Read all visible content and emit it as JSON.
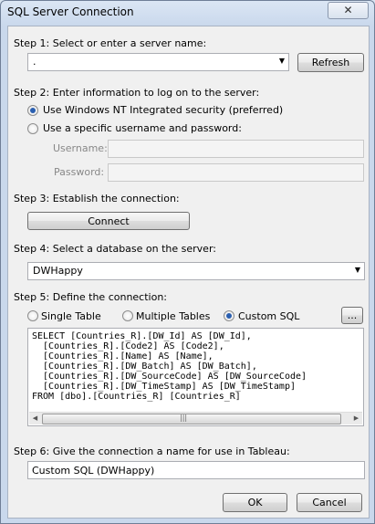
{
  "window": {
    "title": "SQL Server Connection",
    "close_label": "✕"
  },
  "step1": {
    "label": "Step 1: Select or enter a server name:",
    "server_value": ".",
    "refresh_label": "Refresh"
  },
  "step2": {
    "label": "Step 2: Enter information to log on to the server:",
    "option_windows": "Use Windows NT Integrated security (preferred)",
    "option_specific": "Use a specific username and password:",
    "username_label": "Username:",
    "password_label": "Password:",
    "username_value": "",
    "password_value": ""
  },
  "step3": {
    "label": "Step 3: Establish the connection:",
    "connect_label": "Connect"
  },
  "step4": {
    "label": "Step 4: Select a database on the server:",
    "database_value": "DWHappy"
  },
  "step5": {
    "label": "Step 5: Define the connection:",
    "option_single": "Single Table",
    "option_multiple": "Multiple Tables",
    "option_custom": "Custom SQL",
    "ellipsis_label": "...",
    "sql_lines": [
      "SELECT [Countries_R].[DW_Id] AS [DW_Id],",
      "  [Countries_R].[Code2] AS [Code2],",
      "  [Countries_R].[Name] AS [Name],",
      "  [Countries_R].[DW_Batch] AS [DW_Batch],",
      "  [Countries_R].[DW_SourceCode] AS [DW_SourceCode]",
      "  [Countries_R].[DW_TimeStamp] AS [DW_TimeStamp]",
      "FROM [dbo].[Countries_R] [Countries_R]"
    ]
  },
  "step6": {
    "label": "Step 6: Give the connection a name for use in Tableau:",
    "name_value": "Custom SQL (DWHappy)"
  },
  "footer": {
    "ok_label": "OK",
    "cancel_label": "Cancel"
  },
  "state": {
    "auth": "windows",
    "source": "custom_sql"
  }
}
